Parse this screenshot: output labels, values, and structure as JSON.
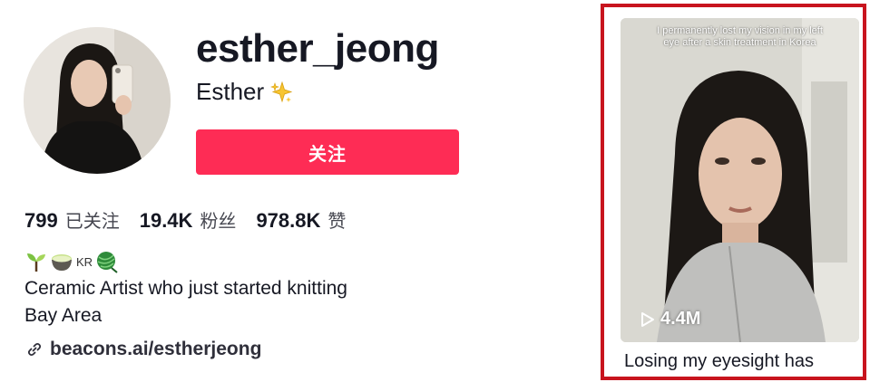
{
  "profile": {
    "username": "esther_jeong",
    "nickname": "Esther",
    "follow_label": "关注",
    "avatar_icon": "profile-photo"
  },
  "stats": [
    {
      "value": "799",
      "label": "已关注"
    },
    {
      "value": "19.4K",
      "label": "粉丝"
    },
    {
      "value": "978.8K",
      "label": "赞"
    }
  ],
  "bio": {
    "emoji_icons": [
      "seedling-icon",
      "yarn-bowl-icon",
      "kr-flag-icon",
      "yarn-ball-icon"
    ],
    "kr_text": "KR",
    "line1": "Ceramic Artist who just started knitting",
    "line2": "Bay Area"
  },
  "link": {
    "text": "beacons.ai/estherjeong",
    "icon": "link-icon"
  },
  "video": {
    "overlay_text": "I permanently lost my vision in my left eye after a skin treatment in Korea",
    "views": "4.4M",
    "title": "Losing my eyesight has"
  },
  "colors": {
    "accent": "#fe2c55",
    "highlight_border": "#c8141e"
  }
}
